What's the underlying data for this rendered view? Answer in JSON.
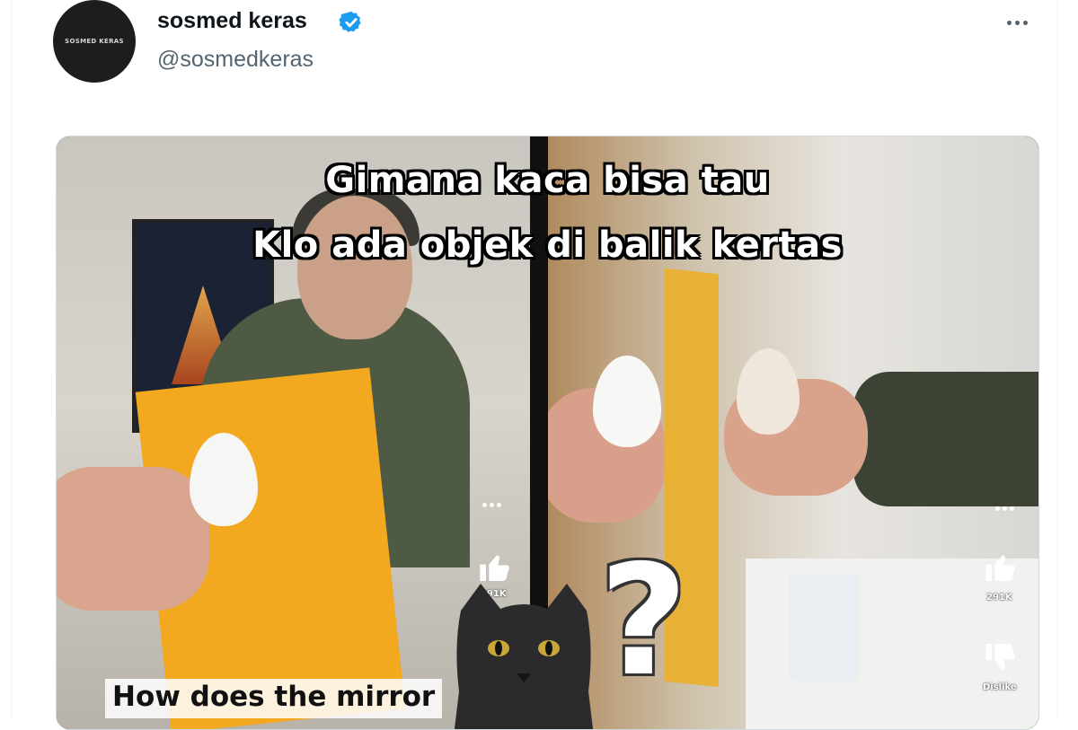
{
  "post": {
    "avatar_text": "SOSMED KERAS",
    "display_name": "sosmed keras",
    "handle": "@sosmedkeras",
    "verified": true
  },
  "media": {
    "overlay_line_1": "Gimana kaca bisa tau",
    "overlay_line_2": "Klo ada objek di balik kertas",
    "caption": "How does the mirror",
    "question_mark": "?",
    "left_like_count": "291K",
    "right_like_count": "291K",
    "right_dislike_label": "Dislike"
  },
  "colors": {
    "verified_blue": "#1d9bf0",
    "paper_yellow": "#f2a91f",
    "text_primary": "#0f1419",
    "text_secondary": "#536471"
  }
}
